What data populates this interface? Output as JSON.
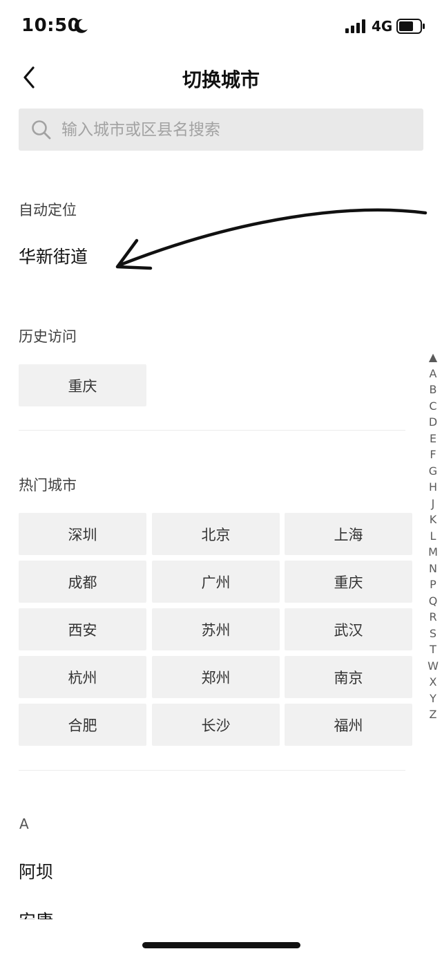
{
  "status_bar": {
    "time": "10:50",
    "network": "4G",
    "icons": [
      "moon-icon",
      "signal-icon",
      "battery-icon"
    ]
  },
  "nav": {
    "title": "切换城市",
    "back_icon": "chevron-left-icon"
  },
  "search": {
    "placeholder": "输入城市或区县名搜索",
    "value": "",
    "icon": "search-icon"
  },
  "auto_location": {
    "title": "自动定位",
    "value": "华新街道"
  },
  "history": {
    "title": "历史访问",
    "cities": [
      "重庆"
    ]
  },
  "hot": {
    "title": "热门城市",
    "cities": [
      "深圳",
      "北京",
      "上海",
      "成都",
      "广州",
      "重庆",
      "西安",
      "苏州",
      "武汉",
      "杭州",
      "郑州",
      "南京",
      "合肥",
      "长沙",
      "福州"
    ]
  },
  "index_bar": {
    "top_symbol": "▲",
    "letters": [
      "A",
      "B",
      "C",
      "D",
      "E",
      "F",
      "G",
      "H",
      "J",
      "K",
      "L",
      "M",
      "N",
      "P",
      "Q",
      "R",
      "S",
      "T",
      "W",
      "X",
      "Y",
      "Z"
    ]
  },
  "city_list": {
    "letter": "A",
    "cities": [
      "阿坝",
      "安康"
    ]
  },
  "colors": {
    "chip_bg": "#f1f1f1",
    "search_bg": "#e9e9e9",
    "text": "#111111",
    "muted": "#3f3f3f"
  }
}
